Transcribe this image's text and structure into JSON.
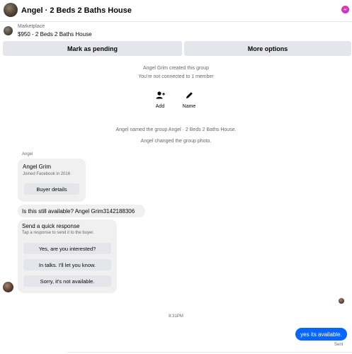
{
  "header": {
    "title": "Angel · 2 Beds 2 Baths House"
  },
  "listing": {
    "label": "Marketplace",
    "price_title": "$950 - 2 Beds 2 Baths House"
  },
  "actions": {
    "pending": "Mark as pending",
    "more": "More options"
  },
  "system": {
    "created": "Angel Grim created this group",
    "not_connected": "You're not connected to 1 member",
    "named": "Angel named the group Angel · 2 Beds 2 Baths House.",
    "photo": "Angel changed the group photo."
  },
  "group_actions": {
    "add": "Add",
    "name": "Name"
  },
  "conversation": {
    "sender": "Angel",
    "profile_card": {
      "name": "Angel Grim",
      "joined": "Joined Facebook in 2016",
      "button": "Buyer details"
    },
    "question": "Is this still available? Angel Grim3142188306",
    "quick": {
      "title": "Send a quick response",
      "subtitle": "Tap a response to send it to the buyer.",
      "options": [
        "Yes, are you interested?",
        "In talks. I'll let you know.",
        "Sorry, it's not available."
      ]
    },
    "timestamp": "8:31PM",
    "reply": "yes its available.",
    "status": "Sent"
  },
  "colors": {
    "accent": "#0866ff",
    "bubble": "#f0f0f0",
    "button": "#e4e6eb"
  }
}
